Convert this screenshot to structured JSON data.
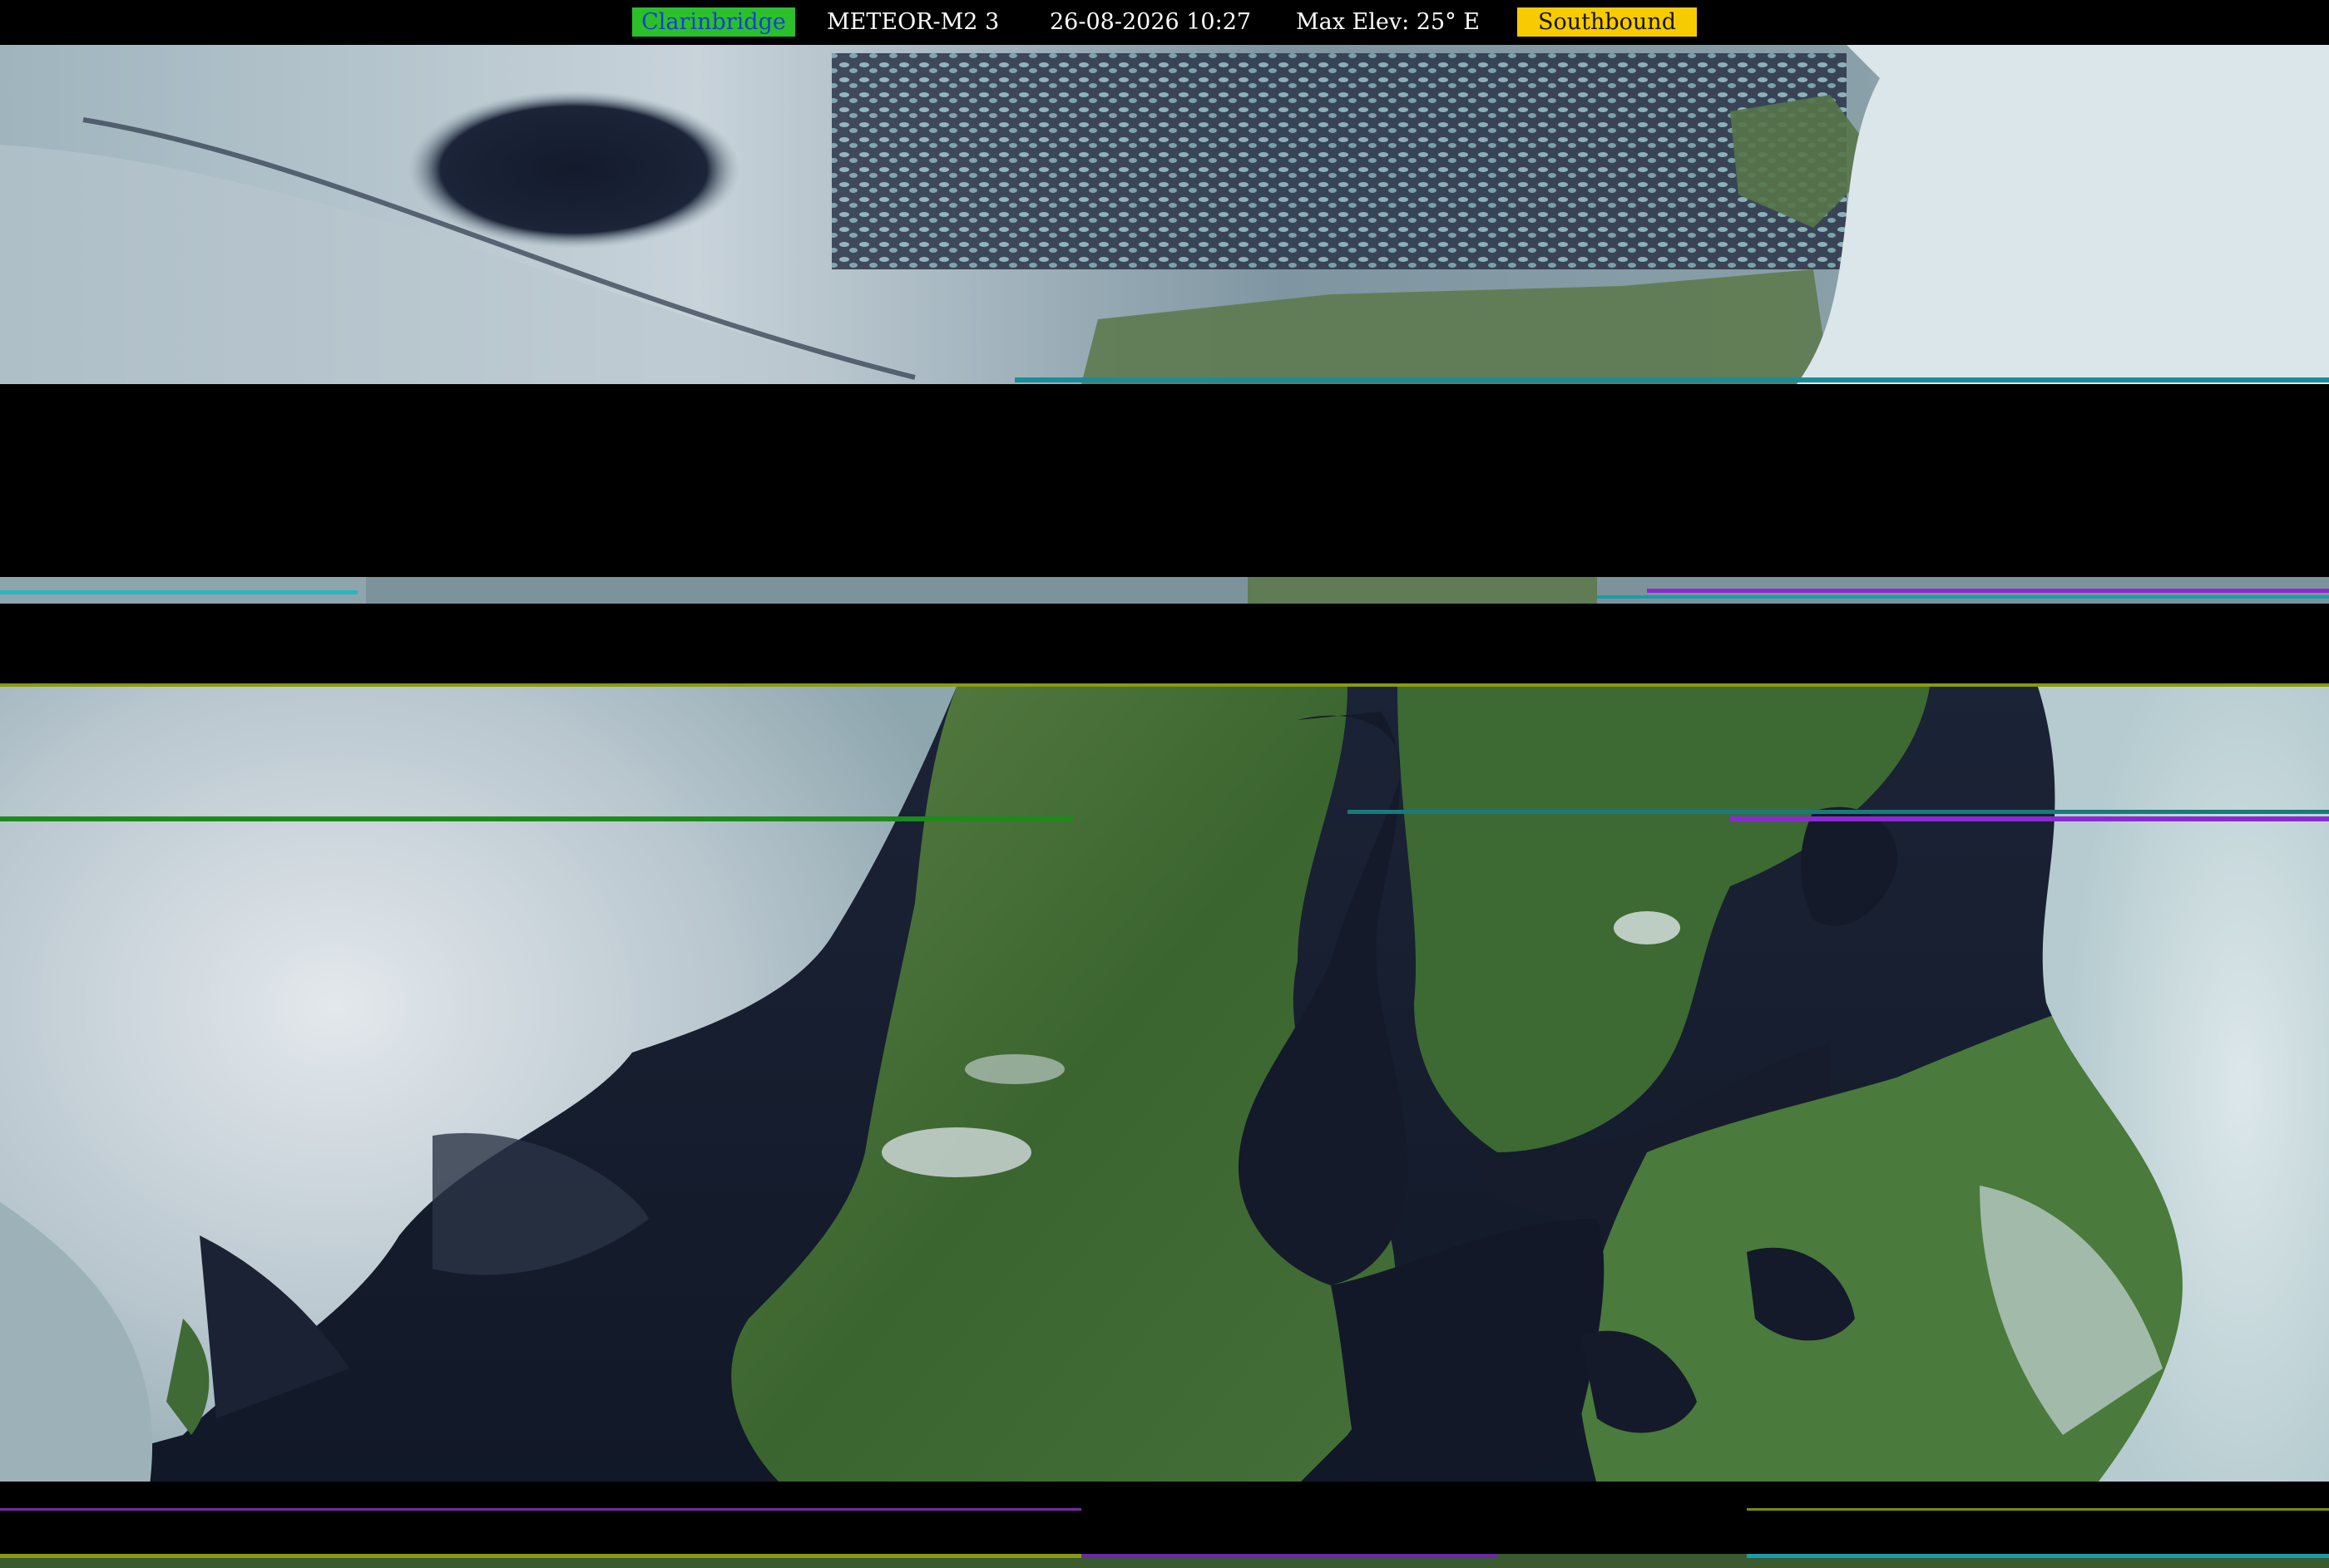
{
  "header": {
    "location": "Clarinbridge",
    "satellite": "METEOR-M2 3",
    "datetime": "26-08-2026 10:27",
    "max_elevation": "Max Elev: 25° E",
    "direction": "Southbound"
  },
  "colors": {
    "location_bg": "#2bc02b",
    "location_text": "#1a3fd0",
    "direction_bg": "#f6cc00",
    "background": "#000000",
    "cloud": "#c9d4dc",
    "land": "#3f6b34",
    "sea": "#141a2c"
  }
}
